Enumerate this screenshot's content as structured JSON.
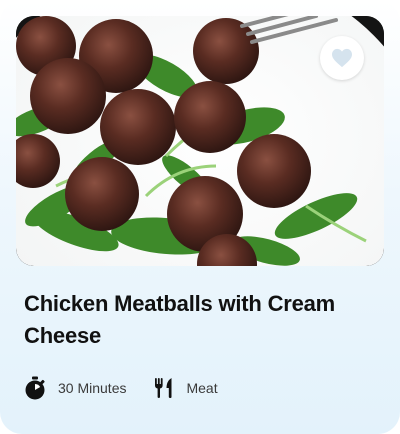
{
  "recipe": {
    "title": "Chicken Meatballs with Cream Cheese",
    "image_alt": "Meatballs on arugula",
    "duration": "30 Minutes",
    "category": "Meat"
  },
  "icons": {
    "favorite": "heart-icon",
    "duration": "stopwatch-icon",
    "category": "fork-knife-icon"
  },
  "colors": {
    "accent_heart": "#d5e3ee",
    "title": "#111111",
    "meta_text": "#3a3a3a",
    "card_tint": "#e3f2fb"
  }
}
